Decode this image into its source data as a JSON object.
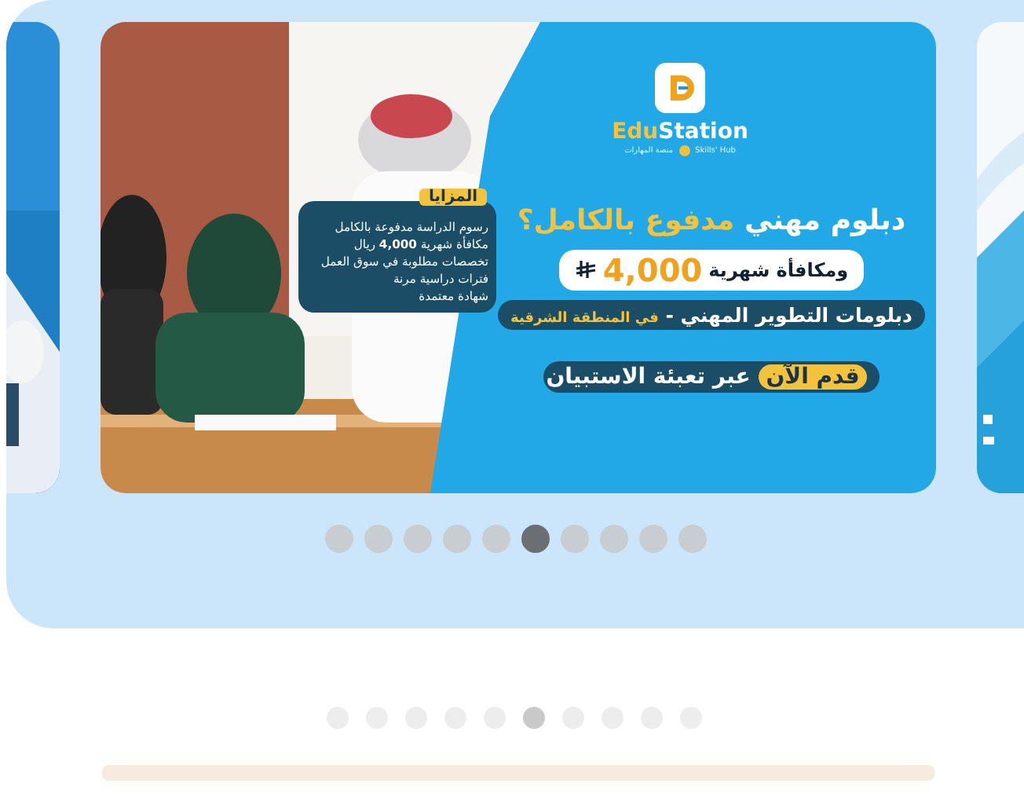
{
  "carousel": {
    "banner": {
      "brand_lead": "Edu",
      "brand_rest": "Station",
      "tagline_en": "Skills' Hub",
      "tagline_ar": "منصة المهارات",
      "headline": "دبلوم مهني",
      "headline_highlight": "مدفوع بالكامل؟",
      "stipend_label": "ومكافأة شهرية",
      "stipend_amount": "4,000",
      "program": "دبلومات التطوير المهني -",
      "program_region": "في المنطقة الشرقية",
      "cta_highlight": "قدم الآن",
      "cta": "عبر تعبئة الاستبيان",
      "features_title": "المزايا",
      "features": [
        "رسوم الدراسة مدفوعة بالكامل",
        "مكافأة شهرية **4,000** ريال",
        "تخصصات مطلوبة في سوق العمل",
        "فترات دراسية مرنة",
        "شهادة معتمدة"
      ]
    },
    "slides": [
      {
        "selected": false
      },
      {
        "selected": false
      },
      {
        "selected": false
      },
      {
        "selected": false
      },
      {
        "selected": false
      },
      {
        "selected": true
      },
      {
        "selected": false
      },
      {
        "selected": false
      },
      {
        "selected": false
      },
      {
        "selected": false
      }
    ]
  }
}
